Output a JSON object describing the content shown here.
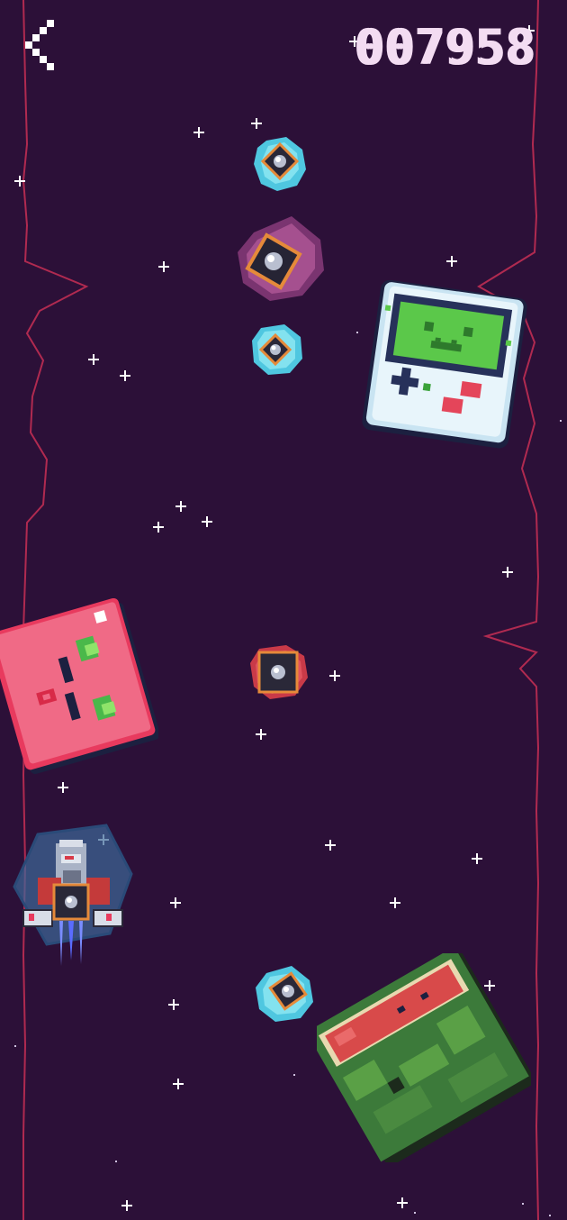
{
  "hud": {
    "score": "007958",
    "back_icon": "chevron-left-icon"
  },
  "colors": {
    "background": "#2c1038",
    "wall": "#b02a50",
    "star": "#ffffff",
    "score": "#f3dcf2"
  },
  "objects": [
    {
      "name": "player-spaceship",
      "icon": "spaceship-icon"
    },
    {
      "name": "blue-asteroid",
      "icon": "asteroid-core-icon"
    },
    {
      "name": "purple-asteroid",
      "icon": "asteroid-core-icon"
    },
    {
      "name": "red-asteroid",
      "icon": "asteroid-core-icon"
    },
    {
      "name": "handheld-console-enemy",
      "icon": "gameboy-icon"
    },
    {
      "name": "pink-block-enemy",
      "icon": "pink-block-icon"
    },
    {
      "name": "watermelon-enemy",
      "icon": "watermelon-icon"
    }
  ]
}
